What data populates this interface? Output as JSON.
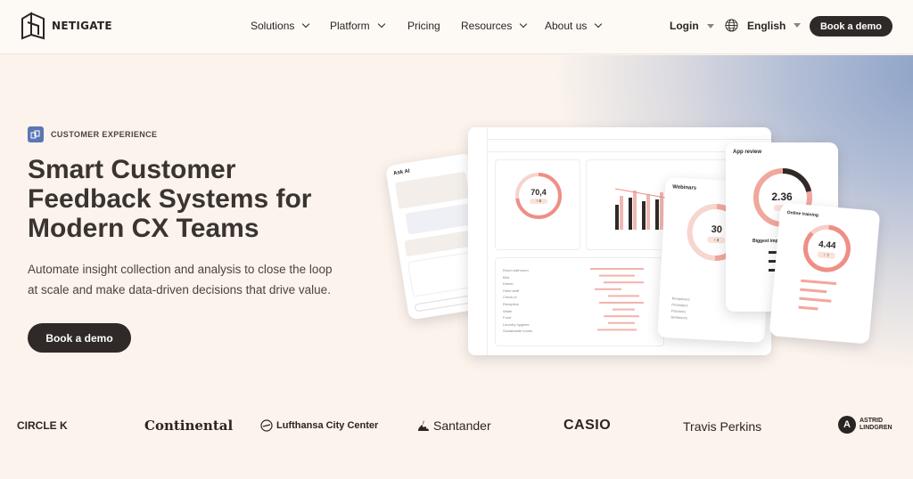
{
  "header": {
    "logo_text": "NETIGATE",
    "nav": [
      {
        "label": "Solutions",
        "has_menu": true
      },
      {
        "label": "Platform",
        "has_menu": true
      },
      {
        "label": "Pricing",
        "has_menu": false
      },
      {
        "label": "Resources",
        "has_menu": true
      },
      {
        "label": "About us",
        "has_menu": true
      }
    ],
    "login_label": "Login",
    "language_label": "English",
    "cta_label": "Book a demo"
  },
  "hero": {
    "badge": "CUSTOMER EXPERIENCE",
    "headline_lines": [
      "Smart Customer",
      "Feedback Systems for",
      "Modern CX Teams"
    ],
    "subtext_lines": [
      "Automate insight collection and analysis to close the loop",
      "at scale and make data-driven decisions that drive value."
    ],
    "cta_label": "Book a demo"
  },
  "mockup": {
    "ask_ai_title": "Ask AI",
    "nps_value": "70,4",
    "nps_delta": "↑ 6",
    "webinars_title": "Webinars",
    "webinars_value": "30",
    "webinars_delta": "↑ 4",
    "app_review_title": "App review",
    "app_review_value": "2.36",
    "app_review_delta": "↓ 4",
    "online_training_title": "Online training",
    "online_training_value": "4.44",
    "online_training_delta": "↑ 7",
    "biggest_impact_label": "Biggest impact",
    "topic_labels": [
      "Room bathroom",
      "Bed",
      "Dinner",
      "Hotel staff",
      "Check-in",
      "Reception",
      "Water",
      "Food",
      "Laundry hygiene",
      "Sustainable rooms"
    ],
    "stats_labels": [
      "Responses",
      "Promoters",
      "Passives",
      "Detractors"
    ]
  },
  "logos": {
    "circle_k": "CIRCLE K",
    "continental": "Continental",
    "lufthansa": "Lufthansa City Center",
    "santander": "Santander",
    "casio": "CASIO",
    "travis_perkins": "Travis Perkins",
    "astrid_line1": "ASTRID",
    "astrid_line2": "LINDGREN"
  },
  "colors": {
    "accent_dark": "#2f2a28",
    "badge_blue": "#5b76b5",
    "salmon": "#f2a8a0",
    "hero_bg": "#fbf3ec"
  }
}
